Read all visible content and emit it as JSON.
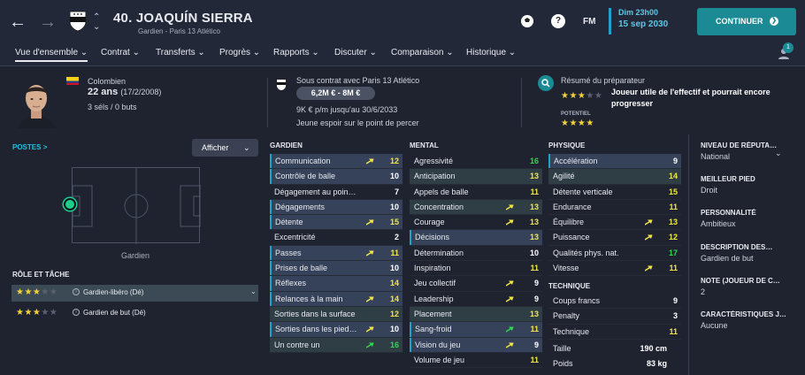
{
  "header": {
    "player_title": "40. JOAQUÍN SIERRA",
    "player_sub": "Gardien - Paris 13 Atlético",
    "date_line1": "Dim 23h00",
    "date_line2": "15 sep 2030",
    "continue_label": "CONTINUER",
    "fm_label": "FM",
    "help_label": "?"
  },
  "nav": {
    "items": [
      "Vue d'ensemble",
      "Contrat",
      "Transferts",
      "Progrès",
      "Rapports",
      "Discuter",
      "Comparaison",
      "Historique"
    ],
    "notif_count": "1"
  },
  "profile": {
    "nationality": "Colombien",
    "age": "22 ans",
    "birth": "(17/2/2008)",
    "caps": "3 séls / 0 buts"
  },
  "contract": {
    "status": "Sous contrat avec Paris 13 Atlético",
    "value": "6,2M € - 8M €",
    "wage": "9K € p/m jusqu'au 30/6/2033",
    "note": "Jeune espoir sur le point de percer"
  },
  "scout": {
    "title": "Résumé du préparateur",
    "judgement": "Joueur utile de l'effectif et pourrait encore progresser",
    "potential_label": "POTENTIEL",
    "current_stars": 3,
    "potential_stars": 3.5
  },
  "left": {
    "positions_label": "POSTES",
    "positions_chevron": ">",
    "show_label": "Afficher",
    "position_name": "Gardien",
    "roles_title": "RÔLE ET TÂCHE",
    "roles": [
      {
        "label": "Gardien-libéro (Dé)",
        "stars": 3,
        "selected": true
      },
      {
        "label": "Gardien de but (Dé)",
        "stars": 3,
        "selected": false
      }
    ]
  },
  "attributes": {
    "gardien_title": "GARDIEN",
    "gardien": [
      {
        "name": "Communication",
        "value": "12",
        "hl": true,
        "arrow": "up"
      },
      {
        "name": "Contrôle de balle",
        "value": "10",
        "hl": true
      },
      {
        "name": "Dégagement au poin…",
        "value": "7"
      },
      {
        "name": "Dégagements",
        "value": "10",
        "hl": true
      },
      {
        "name": "Détente",
        "value": "15",
        "hl": true,
        "arrow": "up"
      },
      {
        "name": "Excentricité",
        "value": "2"
      },
      {
        "name": "Passes",
        "value": "11",
        "hl": true,
        "arrow": "up"
      },
      {
        "name": "Prises de balle",
        "value": "10",
        "hl": true
      },
      {
        "name": "Réflexes",
        "value": "14",
        "hl": true
      },
      {
        "name": "Relances à la main",
        "value": "14",
        "hl": true,
        "arrow": "up"
      },
      {
        "name": "Sorties dans la surface",
        "value": "12",
        "hl": "g"
      },
      {
        "name": "Sorties dans les pied…",
        "value": "10",
        "hl": true,
        "arrow": "up"
      },
      {
        "name": "Un contre un",
        "value": "16",
        "hl": "g",
        "arrow": "upg"
      }
    ],
    "mental_title": "MENTAL",
    "mental": [
      {
        "name": "Agressivité",
        "value": "16"
      },
      {
        "name": "Anticipation",
        "value": "13",
        "hl": "g"
      },
      {
        "name": "Appels de balle",
        "value": "11"
      },
      {
        "name": "Concentration",
        "value": "13",
        "hl": "g",
        "arrow": "up"
      },
      {
        "name": "Courage",
        "value": "13",
        "arrow": "up"
      },
      {
        "name": "Décisions",
        "value": "13",
        "hl": true
      },
      {
        "name": "Détermination",
        "value": "10"
      },
      {
        "name": "Inspiration",
        "value": "11"
      },
      {
        "name": "Jeu collectif",
        "value": "9",
        "arrow": "up"
      },
      {
        "name": "Leadership",
        "value": "9",
        "arrow": "up"
      },
      {
        "name": "Placement",
        "value": "13",
        "hl": "g"
      },
      {
        "name": "Sang-froid",
        "value": "11",
        "hl": true,
        "arrow": "upg"
      },
      {
        "name": "Vision du jeu",
        "value": "9",
        "hl": true,
        "arrow": "up"
      },
      {
        "name": "Volume de jeu",
        "value": "11"
      }
    ],
    "physique_title": "PHYSIQUE",
    "physique": [
      {
        "name": "Accélération",
        "value": "9",
        "hl": true
      },
      {
        "name": "Agilité",
        "value": "14",
        "hl": "g"
      },
      {
        "name": "Détente verticale",
        "value": "15"
      },
      {
        "name": "Endurance",
        "value": "11"
      },
      {
        "name": "Équilibre",
        "value": "13",
        "arrow": "up"
      },
      {
        "name": "Puissance",
        "value": "12",
        "arrow": "up"
      },
      {
        "name": "Qualités phys. nat.",
        "value": "17"
      },
      {
        "name": "Vitesse",
        "value": "11",
        "arrow": "up"
      }
    ],
    "technique_title": "TECHNIQUE",
    "technique": [
      {
        "name": "Coups francs",
        "value": "9"
      },
      {
        "name": "Penalty",
        "value": "3"
      },
      {
        "name": "Technique",
        "value": "11"
      }
    ],
    "size": [
      {
        "name": "Taille",
        "value": "190 cm"
      },
      {
        "name": "Poids",
        "value": "83 kg"
      }
    ]
  },
  "right_info": [
    {
      "h": "NIVEAU DE RÉPUTA…",
      "v": "National"
    },
    {
      "h": "MEILLEUR PIED",
      "v": "Droit"
    },
    {
      "h": "PERSONNALITÉ",
      "v": "Ambitieux"
    },
    {
      "h": "DESCRIPTION DES…",
      "v": "Gardien de but"
    },
    {
      "h": "NOTE (JOUEUR DE C…",
      "v": "2"
    },
    {
      "h": "CARACTÉRISTIQUES J…",
      "v": "Aucune"
    }
  ],
  "colors": {
    "accent": "#1b8a95",
    "highlight": "#21c1de",
    "value_yellow": "#f2e64a",
    "value_green": "#2fd84f",
    "value_white": "#ffffff"
  }
}
